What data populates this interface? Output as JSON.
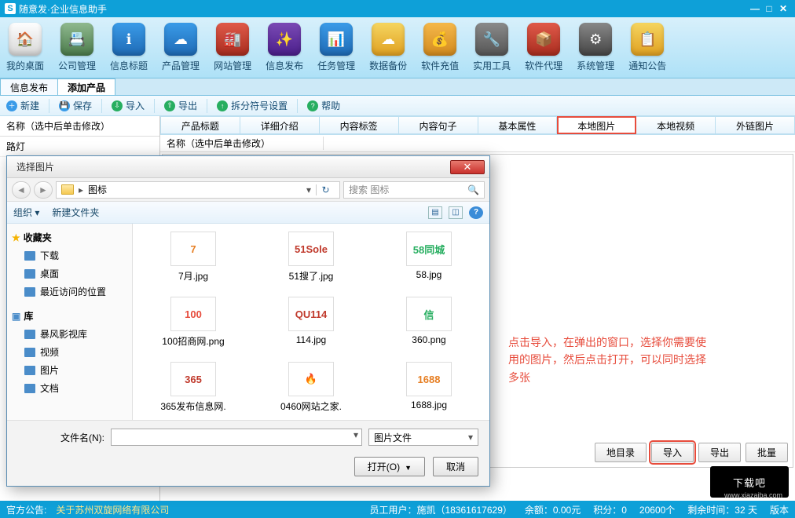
{
  "title": "随意发·企业信息助手",
  "toolbar": [
    {
      "label": "我的桌面",
      "bg": "linear-gradient(#fefefe,#d6d6d6)",
      "glyph": "🏠"
    },
    {
      "label": "公司管理",
      "bg": "linear-gradient(#8fb98f,#4a7a4a)",
      "glyph": "📇"
    },
    {
      "label": "信息标题",
      "bg": "linear-gradient(#3a9be8,#1e6ab5)",
      "glyph": "ℹ"
    },
    {
      "label": "产品管理",
      "bg": "linear-gradient(#3a9be8,#1e6ab5)",
      "glyph": "☁"
    },
    {
      "label": "网站管理",
      "bg": "linear-gradient(#e05a4a,#a82c1e)",
      "glyph": "🏭"
    },
    {
      "label": "信息发布",
      "bg": "linear-gradient(#7a4ab5,#4a1e8a)",
      "glyph": "✨"
    },
    {
      "label": "任务管理",
      "bg": "linear-gradient(#3a9be8,#1e6ab5)",
      "glyph": "📊"
    },
    {
      "label": "数据备份",
      "bg": "linear-gradient(#f5d560,#e0a020)",
      "glyph": "☁"
    },
    {
      "label": "软件充值",
      "bg": "linear-gradient(#f5b84a,#d28a1e)",
      "glyph": "💰"
    },
    {
      "label": "实用工具",
      "bg": "linear-gradient(#8a8a8a,#555)",
      "glyph": "🔧"
    },
    {
      "label": "软件代理",
      "bg": "linear-gradient(#e05a4a,#a82c1e)",
      "glyph": "📦"
    },
    {
      "label": "系统管理",
      "bg": "linear-gradient(#888,#444)",
      "glyph": "⚙"
    },
    {
      "label": "通知公告",
      "bg": "linear-gradient(#f5d560,#e0a020)",
      "glyph": "📋"
    }
  ],
  "doc_tabs": [
    "信息发布",
    "添加产品"
  ],
  "active_doc_tab": 1,
  "sub_toolbar": {
    "new": "新建",
    "save": "保存",
    "import": "导入",
    "export": "导出",
    "split": "拆分符号设置",
    "help": "帮助"
  },
  "left": {
    "header": "名称（选中后单击修改）",
    "row1": "路灯"
  },
  "columns": [
    "产品标题",
    "详细介绍",
    "内容标签",
    "内容句子",
    "基本属性",
    "本地图片",
    "本地视频",
    "外链图片"
  ],
  "highlight_col": 5,
  "sub_header": "名称（选中后单击修改）",
  "hint": "点击导入，在弹出的窗口，选择你需要使用的图片，然后点击打开，可以同时选择多张",
  "bottom_buttons": [
    "地目录",
    "导入",
    "导出",
    "批量"
  ],
  "status": {
    "notice_label": "官方公告:",
    "notice": "关于苏州双旋网络有限公司",
    "user": "员工用户：施凯（18361617629）",
    "balance": "余额：0.00元",
    "points": "积分：0",
    "invites": "20600个",
    "remain": "剩余时间：32 天",
    "version": "版本"
  },
  "dialog": {
    "title": "选择图片",
    "path": "图标",
    "search_placeholder": "搜索 图标",
    "organize": "组织 ▾",
    "new_folder": "新建文件夹",
    "sidebar": {
      "favorites": "收藏夹",
      "fav_items": [
        "下载",
        "桌面",
        "最近访问的位置"
      ],
      "library": "库",
      "lib_items": [
        "暴风影视库",
        "视频",
        "图片",
        "文档"
      ]
    },
    "files": [
      {
        "name": "7月.jpg",
        "color": "#e67e22",
        "txt": "7"
      },
      {
        "name": "51搜了.jpg",
        "color": "#c0392b",
        "txt": "51Sole"
      },
      {
        "name": "58.jpg",
        "color": "#27ae60",
        "txt": "58同城"
      },
      {
        "name": "100招商网.png",
        "color": "#e74c3c",
        "txt": "100"
      },
      {
        "name": "114.jpg",
        "color": "#c0392b",
        "txt": "QU114"
      },
      {
        "name": "360.png",
        "color": "#27ae60",
        "txt": "信"
      },
      {
        "name": "365发布信息网.",
        "color": "#c0392b",
        "txt": "365"
      },
      {
        "name": "0460网站之家.",
        "color": "#d35400",
        "txt": "🔥"
      },
      {
        "name": "1688.jpg",
        "color": "#e67e22",
        "txt": "1688"
      }
    ],
    "filename_label": "文件名(N):",
    "filename_value": "",
    "filetype": "图片文件",
    "open": "打开(O)",
    "cancel": "取消"
  },
  "watermark": "下载吧",
  "watermark_url": "www.xiazaiba.com"
}
